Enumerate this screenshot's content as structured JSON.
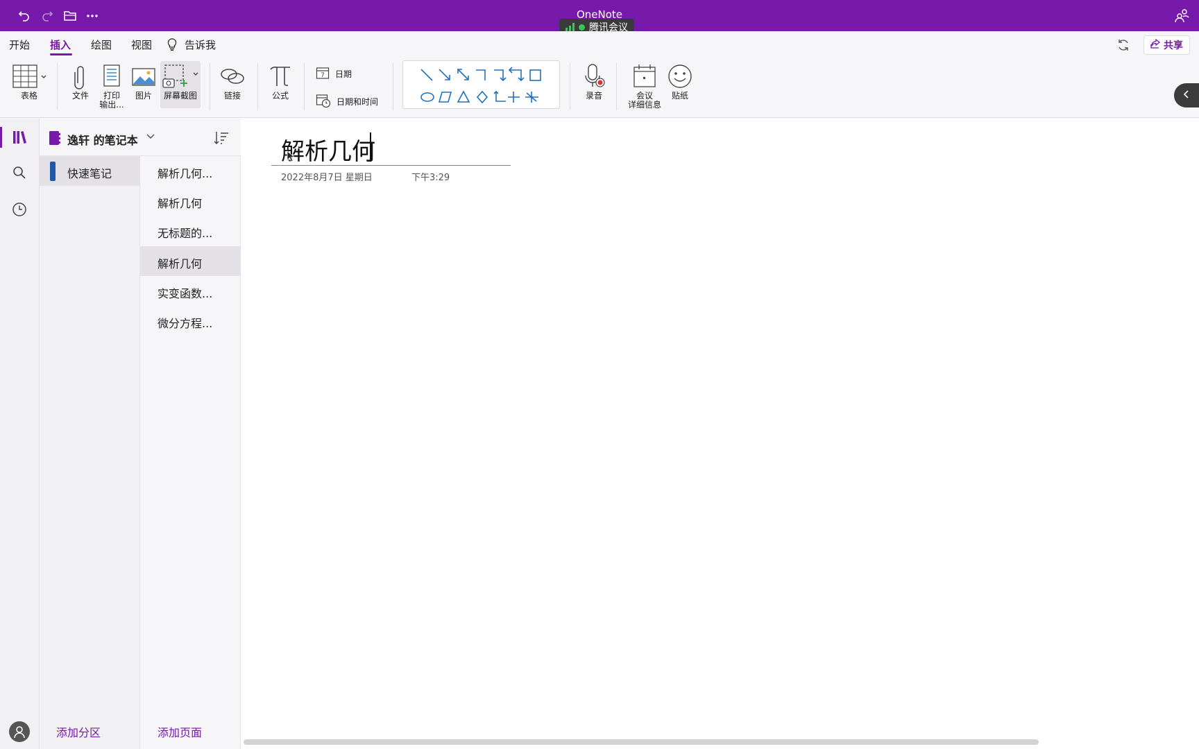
{
  "app": {
    "title": "OneNote",
    "meeting_badge": "腾讯会议"
  },
  "menu": {
    "tabs": [
      {
        "label": "开始"
      },
      {
        "label": "插入"
      },
      {
        "label": "绘图"
      },
      {
        "label": "视图"
      },
      {
        "label": "告诉我"
      }
    ],
    "active_tab": "插入",
    "share_label": "共享"
  },
  "ribbon": {
    "table": "表格",
    "file": "文件",
    "printout_line1": "打印",
    "printout_line2": "输出...",
    "picture": "图片",
    "screenshot": "屏幕截图",
    "link": "链接",
    "equation": "公式",
    "date": "日期",
    "datetime": "日期和时间",
    "date_icon_number": "7",
    "audio": "录音",
    "meeting_line1": "会议",
    "meeting_line2": "详细信息",
    "sticker": "贴纸"
  },
  "notebook": {
    "name": "逸轩 的笔记本"
  },
  "sections": {
    "items": [
      {
        "label": "快速笔记",
        "color": "#1f58a7"
      }
    ],
    "add_label": "添加分区"
  },
  "pages": {
    "items": [
      {
        "label": "解析几何..."
      },
      {
        "label": "解析几何"
      },
      {
        "label": "无标题的..."
      },
      {
        "label": "解析几何"
      },
      {
        "label": "实变函数..."
      },
      {
        "label": "微分方程..."
      }
    ],
    "active_index": 3,
    "add_label": "添加页面"
  },
  "page": {
    "title": "解析几何",
    "date": "2022年8月7日 星期日",
    "time": "下午3:29"
  },
  "colors": {
    "accent": "#7719aa",
    "section_blue": "#1f58a7"
  }
}
